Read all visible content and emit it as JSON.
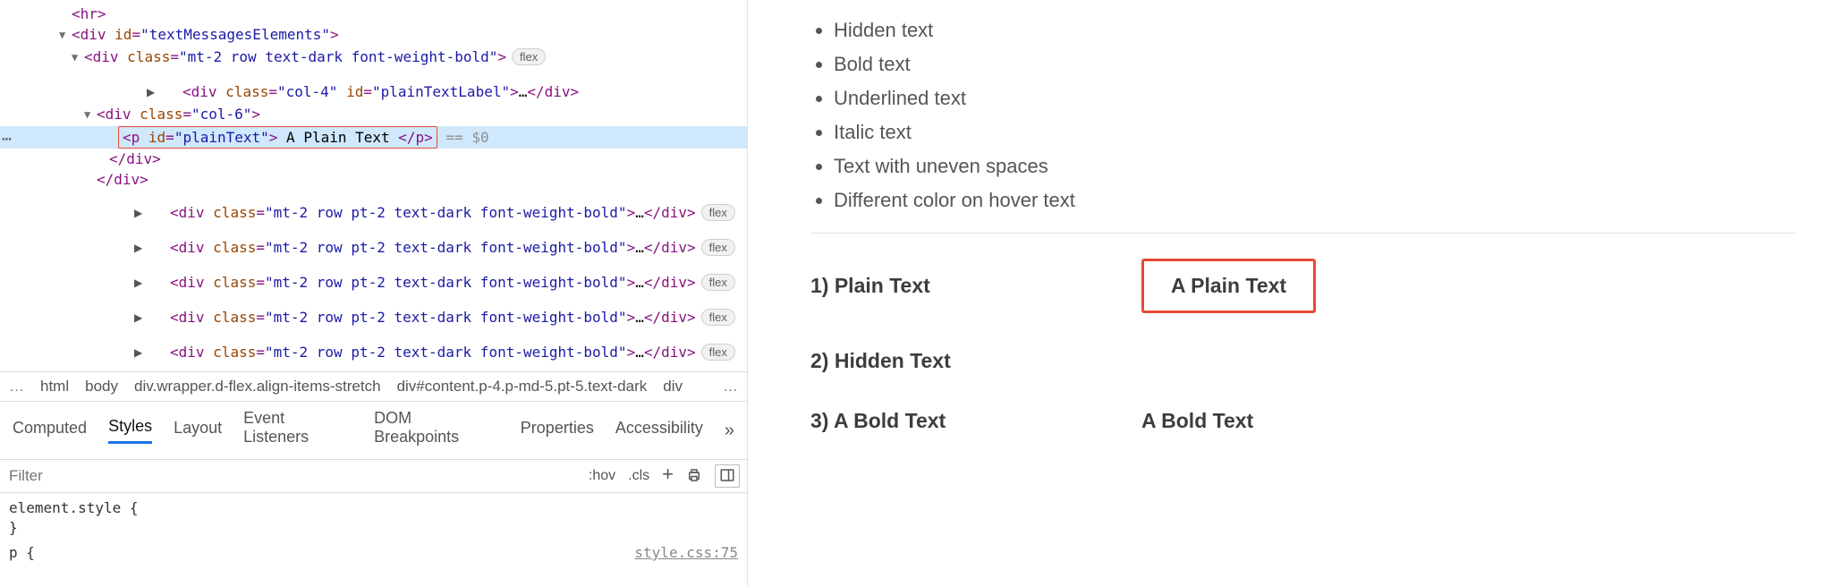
{
  "dom": {
    "lines": [
      {
        "indent": 80,
        "arrow": "",
        "parts": [
          {
            "t": "tag",
            "v": "<hr>"
          }
        ]
      },
      {
        "indent": 80,
        "arrow": "down",
        "parts": [
          {
            "t": "tag",
            "v": "<div "
          },
          {
            "t": "attr-name",
            "v": "id"
          },
          {
            "t": "tag",
            "v": "="
          },
          {
            "t": "string",
            "v": "\"textMessagesElements\""
          },
          {
            "t": "tag",
            "v": ">"
          }
        ]
      },
      {
        "indent": 94,
        "arrow": "down",
        "parts": [
          {
            "t": "tag",
            "v": "<div "
          },
          {
            "t": "attr-name",
            "v": "class"
          },
          {
            "t": "tag",
            "v": "="
          },
          {
            "t": "string",
            "v": "\"mt-2 row text-dark font-weight-bold\""
          },
          {
            "t": "tag",
            "v": ">"
          }
        ],
        "badge": "flex"
      },
      {
        "indent": 108,
        "arrow": "right",
        "parts": [
          {
            "t": "tag",
            "v": "<div "
          },
          {
            "t": "attr-name",
            "v": "class"
          },
          {
            "t": "tag",
            "v": "="
          },
          {
            "t": "string",
            "v": "\"col-4\""
          },
          {
            "t": "tag",
            "v": " "
          },
          {
            "t": "attr-name",
            "v": "id"
          },
          {
            "t": "tag",
            "v": "="
          },
          {
            "t": "string",
            "v": "\"plainTextLabel\""
          },
          {
            "t": "tag",
            "v": ">"
          },
          {
            "t": "collapsed-dots",
            "v": "…"
          },
          {
            "t": "tag",
            "v": "</div>"
          }
        ]
      },
      {
        "indent": 108,
        "arrow": "down",
        "parts": [
          {
            "t": "tag",
            "v": "<div "
          },
          {
            "t": "attr-name",
            "v": "class"
          },
          {
            "t": "tag",
            "v": "="
          },
          {
            "t": "string",
            "v": "\"col-6\""
          },
          {
            "t": "tag",
            "v": ">"
          }
        ]
      },
      {
        "indent": 132,
        "arrow": "",
        "selected": true,
        "hiliteParts": [
          {
            "t": "tag",
            "v": "<p "
          },
          {
            "t": "attr-name",
            "v": "id"
          },
          {
            "t": "tag",
            "v": "="
          },
          {
            "t": "string",
            "v": "\"plainText\""
          },
          {
            "t": "tag",
            "v": ">"
          },
          {
            "t": "text-node",
            "v": " A Plain Text "
          },
          {
            "t": "tag",
            "v": "</p>"
          }
        ],
        "suffix": " == $0"
      },
      {
        "indent": 122,
        "arrow": "",
        "parts": [
          {
            "t": "tag",
            "v": "</div>"
          }
        ]
      },
      {
        "indent": 108,
        "arrow": "",
        "parts": [
          {
            "t": "tag",
            "v": "</div>"
          }
        ]
      },
      {
        "indent": 94,
        "arrow": "right",
        "parts": [
          {
            "t": "tag",
            "v": "<div "
          },
          {
            "t": "attr-name",
            "v": "class"
          },
          {
            "t": "tag",
            "v": "="
          },
          {
            "t": "string",
            "v": "\"mt-2 row pt-2 text-dark font-weight-bold\""
          },
          {
            "t": "tag",
            "v": ">"
          },
          {
            "t": "collapsed-dots",
            "v": "…"
          },
          {
            "t": "tag",
            "v": "</div>"
          }
        ],
        "badge": "flex"
      },
      {
        "indent": 94,
        "arrow": "right",
        "parts": [
          {
            "t": "tag",
            "v": "<div "
          },
          {
            "t": "attr-name",
            "v": "class"
          },
          {
            "t": "tag",
            "v": "="
          },
          {
            "t": "string",
            "v": "\"mt-2 row pt-2 text-dark font-weight-bold\""
          },
          {
            "t": "tag",
            "v": ">"
          },
          {
            "t": "collapsed-dots",
            "v": "…"
          },
          {
            "t": "tag",
            "v": "</div>"
          }
        ],
        "badge": "flex"
      },
      {
        "indent": 94,
        "arrow": "right",
        "parts": [
          {
            "t": "tag",
            "v": "<div "
          },
          {
            "t": "attr-name",
            "v": "class"
          },
          {
            "t": "tag",
            "v": "="
          },
          {
            "t": "string",
            "v": "\"mt-2 row pt-2 text-dark font-weight-bold\""
          },
          {
            "t": "tag",
            "v": ">"
          },
          {
            "t": "collapsed-dots",
            "v": "…"
          },
          {
            "t": "tag",
            "v": "</div>"
          }
        ],
        "badge": "flex"
      },
      {
        "indent": 94,
        "arrow": "right",
        "parts": [
          {
            "t": "tag",
            "v": "<div "
          },
          {
            "t": "attr-name",
            "v": "class"
          },
          {
            "t": "tag",
            "v": "="
          },
          {
            "t": "string",
            "v": "\"mt-2 row pt-2 text-dark font-weight-bold\""
          },
          {
            "t": "tag",
            "v": ">"
          },
          {
            "t": "collapsed-dots",
            "v": "…"
          },
          {
            "t": "tag",
            "v": "</div>"
          }
        ],
        "badge": "flex"
      },
      {
        "indent": 94,
        "arrow": "right",
        "parts": [
          {
            "t": "tag",
            "v": "<div "
          },
          {
            "t": "attr-name",
            "v": "class"
          },
          {
            "t": "tag",
            "v": "="
          },
          {
            "t": "string",
            "v": "\"mt-2 row pt-2 text-dark font-weight-bold\""
          },
          {
            "t": "tag",
            "v": ">"
          },
          {
            "t": "collapsed-dots",
            "v": "…"
          },
          {
            "t": "tag",
            "v": "</div>"
          }
        ],
        "badge": "flex"
      }
    ]
  },
  "breadcrumb": {
    "prefix": "…",
    "items": [
      "html",
      "body",
      "div.wrapper.d-flex.align-items-stretch",
      "div#content.p-4.p-md-5.pt-5.text-dark",
      "div"
    ],
    "overflow": "…"
  },
  "stylesTabs": {
    "items": [
      "Computed",
      "Styles",
      "Layout",
      "Event Listeners",
      "DOM Breakpoints",
      "Properties",
      "Accessibility"
    ],
    "active": 1,
    "more": "»"
  },
  "filterBar": {
    "placeholder": "Filter",
    "tools": {
      "hov": ":hov",
      "cls": ".cls",
      "plus": "+",
      "print": "print-icon",
      "panel": "panel-icon"
    }
  },
  "rules": {
    "element_style_head": "element.style {",
    "element_style_close": "}",
    "p_rule": "p {",
    "source": "style.css:75"
  },
  "page": {
    "bullets": [
      "Hidden text",
      "Bold text",
      "Underlined text",
      "Italic text",
      "Text with uneven spaces",
      "Different color on hover text"
    ],
    "rows": [
      {
        "label": "1) Plain Text",
        "value": "A Plain Text",
        "boxed": true
      },
      {
        "label": "2) Hidden Text",
        "value": "",
        "boxed": false
      },
      {
        "label": "3) A Bold Text",
        "value": "A Bold Text",
        "boxed": false
      }
    ]
  }
}
